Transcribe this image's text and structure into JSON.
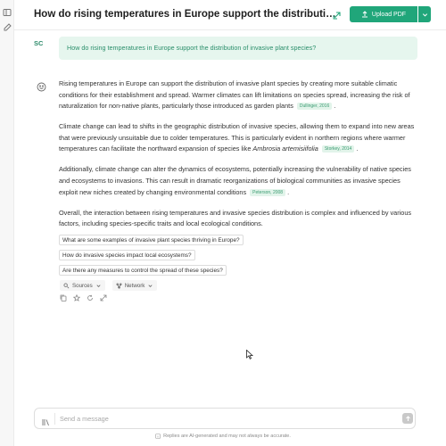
{
  "header": {
    "title": "How do rising temperatures in Europe support the distribution of invasive plant species?",
    "upload_label": "Upload PDF"
  },
  "question": {
    "avatar": "SC",
    "text": "How do rising temperatures in Europe support the distribution of invasive plant species?"
  },
  "answer": {
    "p1": "Rising temperatures in Europe can support the distribution of invasive plant species by creating more suitable climatic conditions for their establishment and spread. Warmer climates can lift limitations on species spread, increasing the risk of naturalization for non-native plants, particularly those introduced as garden plants",
    "p1_cite": "Dullinger, 2016",
    "p2_a": "Climate change can lead to shifts in the geographic distribution of invasive species, allowing them to expand into new areas that were previously unsuitable due to colder temperatures. This is particularly evident in northern regions where warmer temperatures can facilitate the northward expansion of species like ",
    "p2_species": "Ambrosia artemisiifolia",
    "p2_cite": "Storkey, 2014",
    "p3": "Additionally, climate change can alter the dynamics of ecosystems, potentially increasing the vulnerability of native species and ecosystems to invasions. This can result in dramatic reorganizations of biological communities as invasive species exploit new niches created by changing environmental conditions",
    "p3_cite": "Peterson, 2008",
    "p4": "Overall, the interaction between rising temperatures and invasive species distribution is complex and influenced by various factors, including species-specific traits and local ecological conditions.",
    "period": "."
  },
  "suggestions": [
    "What are some examples of invasive plant species thriving in Europe?",
    "How do invasive species impact local ecosystems?",
    "Are there any measures to control the spread of these species?"
  ],
  "chips": {
    "sources": "Sources",
    "network": "Network"
  },
  "composer": {
    "placeholder": "Send a message",
    "disclaimer": "Replies are AI-generated and may not always be accurate."
  },
  "colors": {
    "accent": "#20a67a",
    "question_bg": "#e6f6ee",
    "question_text": "#2b8f6b",
    "cite_bg": "#e2f4ea"
  },
  "icons": [
    "sidebar-toggle-icon",
    "new-chat-icon",
    "share-icon",
    "upload-icon",
    "chevron-down-icon",
    "ai-avatar-icon",
    "sources-icon",
    "network-icon",
    "copy-icon",
    "star-icon",
    "refresh-icon",
    "expand-icon",
    "library-icon",
    "send-icon",
    "info-icon"
  ]
}
